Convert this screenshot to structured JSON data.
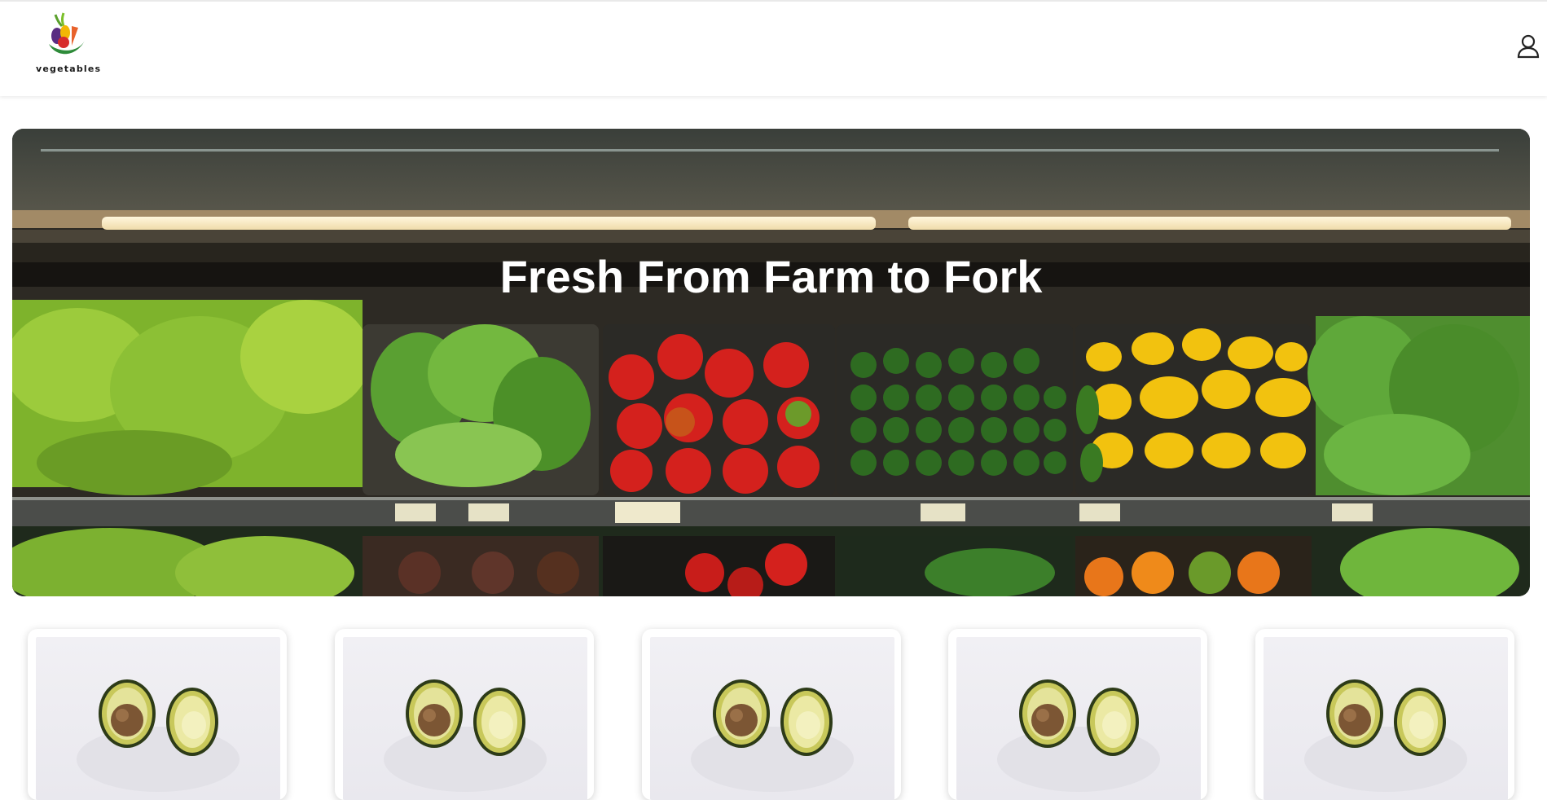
{
  "header": {
    "logo_text": "vegetables",
    "user_icon": "user-icon"
  },
  "hero": {
    "title": "Fresh From Farm to Fork"
  },
  "products": [
    {
      "image_icon": "avocado-image"
    },
    {
      "image_icon": "avocado-image"
    },
    {
      "image_icon": "avocado-image"
    },
    {
      "image_icon": "avocado-image"
    },
    {
      "image_icon": "avocado-image"
    }
  ],
  "colors": {
    "header_bg": "#ffffff",
    "hero_title": "#ffffff",
    "page_bg": "#ffffff"
  }
}
